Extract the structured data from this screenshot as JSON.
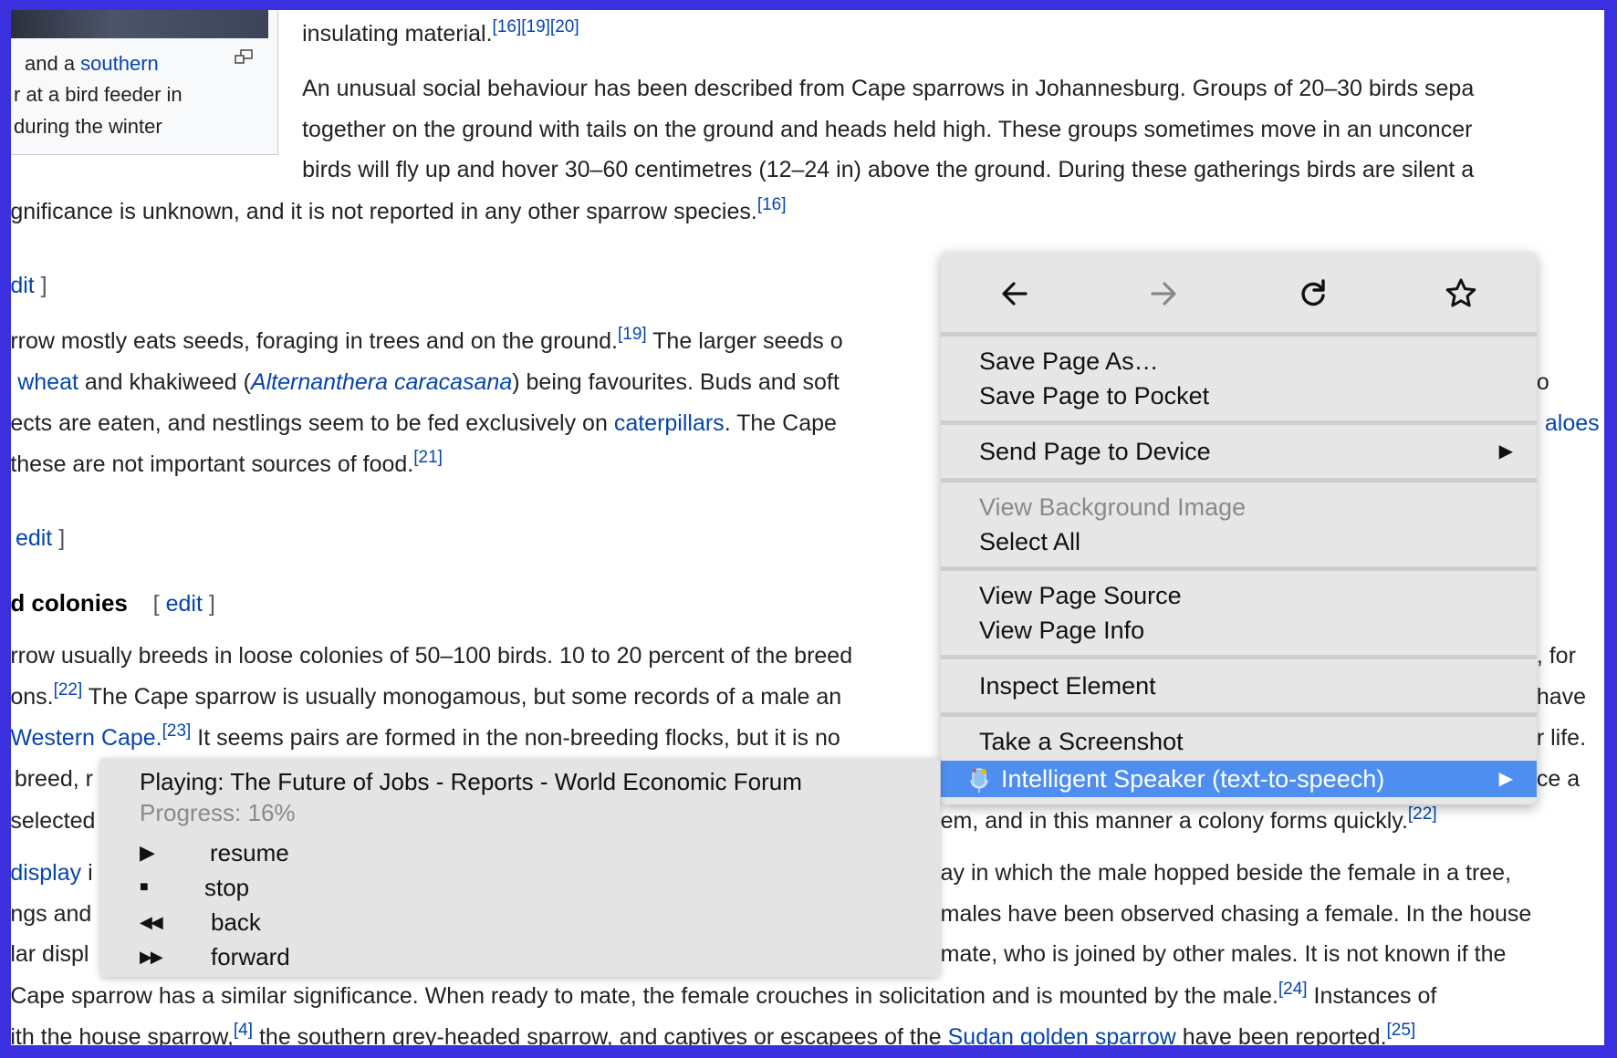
{
  "thumbnail": {
    "caption_lines": [
      [
        {
          "t": "and a "
        },
        {
          "t": "southern",
          "link": true
        }
      ],
      [
        {
          "t": "r at a bird feeder in"
        }
      ],
      [
        {
          "t": "during the winter"
        }
      ]
    ],
    "enlarge_icon": "enlarge-icon"
  },
  "article": {
    "lines": [
      [
        {
          "t": "insulating material."
        },
        {
          "t": "[16][19][20]",
          "sup": true
        }
      ],
      [
        {
          "t": "An unusual social behaviour has been described from Cape sparrows in Johannesburg. Groups of 20–30 birds sepa"
        }
      ],
      [
        {
          "t": "together on the ground with tails on the ground and heads held high. These groups sometimes move in an unconcer"
        }
      ],
      [
        {
          "t": "birds will fly up and hover 30–60 centimetres (12–24 in) above the ground. During these gatherings birds are silent a"
        }
      ],
      [
        {
          "t": "gnificance is unknown, and it is not reported in any other sparrow species."
        },
        {
          "t": "[16]",
          "sup": true
        }
      ],
      [
        {
          "t": "dit",
          "link": true
        },
        {
          "t": " ]",
          "edit": true
        }
      ],
      [
        {
          "t": "rrow mostly eats seeds, foraging in trees and on the ground."
        },
        {
          "t": "[19]",
          "sup": true
        },
        {
          "t": " The larger seeds o"
        }
      ],
      [
        {
          "t": "wheat",
          "link": true
        },
        {
          "t": " and khakiweed ("
        },
        {
          "t": "Alternanthera caracasana",
          "link": true,
          "italic": true
        },
        {
          "t": ") being favourites. Buds and soft"
        }
      ],
      [
        {
          "t": "ects are eaten, and nestlings seem to be fed exclusively on "
        },
        {
          "t": "caterpillars",
          "link": true
        },
        {
          "t": ". The Cape"
        }
      ],
      [
        {
          "t": "these are not important sources of food."
        },
        {
          "t": "[21]",
          "sup": true
        }
      ],
      [
        {
          "t": "edit",
          "link": true
        },
        {
          "t": " ]",
          "edit": true
        }
      ],
      [
        {
          "t": "d colonies",
          "heading": true
        },
        {
          "t": "    [ ",
          "edit": true
        },
        {
          "t": "edit",
          "link": true
        },
        {
          "t": " ]",
          "edit": true
        }
      ],
      [
        {
          "t": "rrow usually breeds in loose colonies of 50–100 birds. 10 to 20 percent of the breed"
        }
      ],
      [
        {
          "t": "ons."
        },
        {
          "t": "[22]",
          "sup": true
        },
        {
          "t": " The Cape sparrow is usually monogamous, but some records of a male an"
        }
      ],
      [
        {
          "t": "Western Cape.",
          "link": true
        },
        {
          "t": "[23]",
          "sup": true
        },
        {
          "t": " It seems pairs are formed in the non-breeding flocks, but it is no"
        }
      ],
      [
        {
          "t": "breed, r"
        }
      ],
      [
        {
          "t": "selected"
        }
      ],
      [
        {
          "t": "display",
          "link": true
        },
        {
          "t": " i"
        }
      ],
      [
        {
          "t": "ngs and"
        }
      ],
      [
        {
          "t": "lar displ"
        }
      ],
      [
        {
          "t": "Cape sparrow has a similar significance. When ready to mate, the female crouches in solicitation and is mounted by the male."
        },
        {
          "t": "[24]",
          "sup": true
        },
        {
          "t": " Instances of"
        }
      ],
      [
        {
          "t": "ith the house sparrow,"
        },
        {
          "t": "[4]",
          "sup": true
        },
        {
          "t": " the southern grey-headed sparrow, and captives or escapees of the "
        },
        {
          "t": "Sudan golden sparrow",
          "link": true
        },
        {
          "t": " have been reported."
        },
        {
          "t": "[25]",
          "sup": true
        }
      ]
    ],
    "right_fragments": [
      [
        {
          "t": "o"
        }
      ],
      [
        {
          "t": "aloes",
          "link": true
        }
      ],
      [
        {
          "t": ", for"
        }
      ],
      [
        {
          "t": "have"
        }
      ],
      [
        {
          "t": "r life."
        }
      ],
      [
        {
          "t": "ce a"
        }
      ],
      [
        {
          "t": "em, and in this manner a colony forms quickly."
        },
        {
          "t": "[22]",
          "sup": true
        }
      ],
      [
        {
          "t": "ay in which the male hopped beside the female in a tree,"
        }
      ],
      [
        {
          "t": "males have been observed chasing a female. In the house"
        }
      ],
      [
        {
          "t": "mate, who is joined by other males. It is not known if the"
        }
      ]
    ]
  },
  "context_menu": {
    "toolbar": [
      {
        "icon": "back-arrow-icon",
        "enabled": true
      },
      {
        "icon": "forward-arrow-icon",
        "enabled": false
      },
      {
        "icon": "reload-icon",
        "enabled": true
      },
      {
        "icon": "bookmark-star-icon",
        "enabled": true
      }
    ],
    "groups": [
      [
        {
          "label": "Save Page As…"
        },
        {
          "label": "Save Page to Pocket"
        }
      ],
      [
        {
          "label": "Send Page to Device",
          "submenu": true
        }
      ],
      [
        {
          "label": "View Background Image",
          "disabled": true
        },
        {
          "label": "Select All"
        }
      ],
      [
        {
          "label": "View Page Source"
        },
        {
          "label": "View Page Info"
        }
      ],
      [
        {
          "label": "Inspect Element"
        }
      ],
      [
        {
          "label": "Take a Screenshot"
        },
        {
          "label": "Intelligent Speaker (text-to-speech)",
          "submenu": true,
          "highlighted": true,
          "icon": "microphone-icon"
        }
      ]
    ],
    "submenu_arrow": "▶",
    "highlight_color": "#4d8ef0"
  },
  "speaker_panel": {
    "title": "Playing: The Future of Jobs - Reports - World Economic Forum",
    "progress_label": "Progress: 16%",
    "progress_percent": 16,
    "controls": [
      {
        "icon": "play-icon",
        "glyph": "▶",
        "label": "resume"
      },
      {
        "icon": "stop-icon",
        "glyph": "■",
        "label": "stop"
      },
      {
        "icon": "rewind-icon",
        "glyph": "◀◀",
        "label": "back"
      },
      {
        "icon": "fast-forward-icon",
        "glyph": "▶▶",
        "label": "forward"
      }
    ]
  },
  "colors": {
    "border": "#3a30e0",
    "link": "#0645ad",
    "menu_bg": "#e6e6e6"
  }
}
